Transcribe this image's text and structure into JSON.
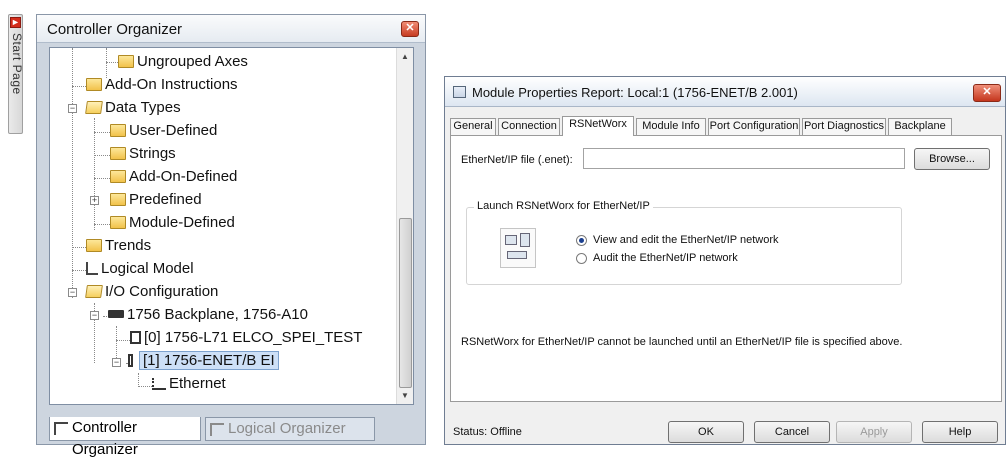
{
  "start_page": {
    "label": "Start Page"
  },
  "organizer": {
    "title": "Controller Organizer",
    "tree": [
      {
        "label": "Ungrouped Axes"
      },
      {
        "label": "Add-On Instructions"
      },
      {
        "label": "Data Types"
      },
      {
        "label": "User-Defined"
      },
      {
        "label": "Strings"
      },
      {
        "label": "Add-On-Defined"
      },
      {
        "label": "Predefined"
      },
      {
        "label": "Module-Defined"
      },
      {
        "label": "Trends"
      },
      {
        "label": "Logical Model"
      },
      {
        "label": "I/O Configuration"
      },
      {
        "label": "1756 Backplane, 1756-A10"
      },
      {
        "label": "[0] 1756-L71 ELCO_SPEI_TEST"
      },
      {
        "label": "[1] 1756-ENET/B EI"
      },
      {
        "label": "Ethernet"
      }
    ],
    "tabs": [
      "Controller Organizer",
      "Logical Organizer"
    ]
  },
  "dialog": {
    "title": "Module Properties Report: Local:1 (1756-ENET/B 2.001)",
    "tabs": [
      "General",
      "Connection",
      "RSNetWorx",
      "Module Info",
      "Port Configuration",
      "Port Diagnostics",
      "Backplane"
    ],
    "active_tab": "RSNetWorx",
    "file_label": "EtherNet/IP file (.enet):",
    "file_value": "",
    "browse_label": "Browse...",
    "group_label": "Launch RSNetWorx for EtherNet/IP",
    "radio_options": [
      "View and edit the EtherNet/IP network",
      "Audit the EtherNet/IP network"
    ],
    "selected_option": "View and edit the EtherNet/IP network",
    "message": "RSNetWorx for EtherNet/IP cannot be launched until an EtherNet/IP file is specified above.",
    "status": "Status:  Offline",
    "buttons": {
      "ok": "OK",
      "cancel": "Cancel",
      "apply": "Apply",
      "help": "Help"
    }
  }
}
